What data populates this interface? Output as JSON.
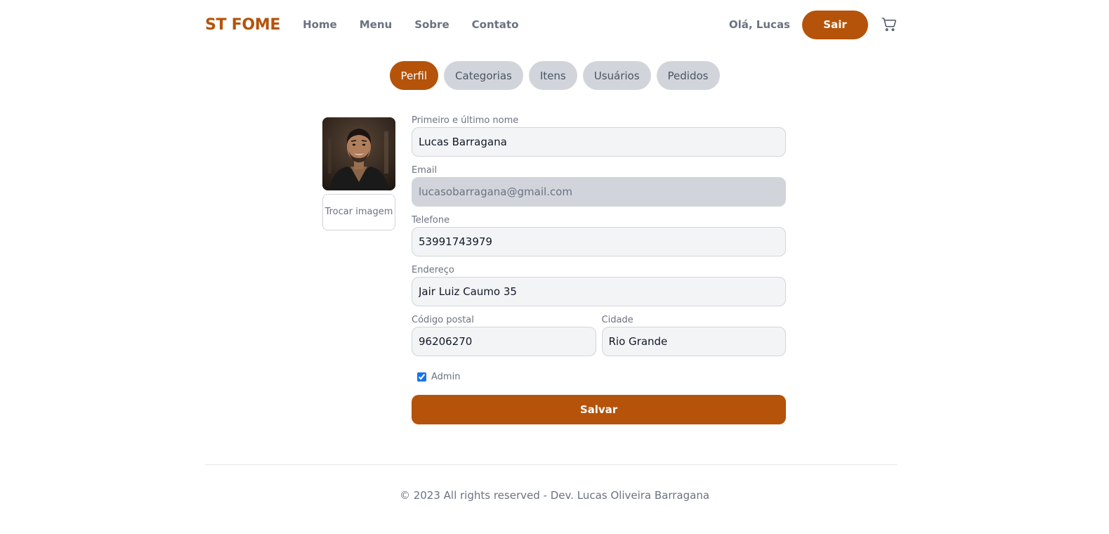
{
  "header": {
    "logo": "ST FOME",
    "nav": [
      {
        "label": "Home"
      },
      {
        "label": "Menu"
      },
      {
        "label": "Sobre"
      },
      {
        "label": "Contato"
      }
    ],
    "greeting": "Olá, Lucas",
    "logout_label": "Sair",
    "cart_icon": "cart-icon"
  },
  "tabs": [
    {
      "label": "Perfil",
      "active": true
    },
    {
      "label": "Categorias",
      "active": false
    },
    {
      "label": "Itens",
      "active": false
    },
    {
      "label": "Usuários",
      "active": false
    },
    {
      "label": "Pedidos",
      "active": false
    }
  ],
  "profile": {
    "change_image_label": "Trocar imagem",
    "name": {
      "label": "Primeiro e último nome",
      "value": "Lucas Barragana"
    },
    "email": {
      "label": "Email",
      "value": "lucasobarragana@gmail.com"
    },
    "phone": {
      "label": "Telefone",
      "value": "53991743979"
    },
    "address": {
      "label": "Endereço",
      "value": "Jair Luiz Caumo 35"
    },
    "postal_code": {
      "label": "Código postal",
      "value": "96206270"
    },
    "city": {
      "label": "Cidade",
      "value": "Rio Grande"
    },
    "admin": {
      "label": "Admin",
      "checked": true
    },
    "save_label": "Salvar"
  },
  "footer": {
    "text": "© 2023 All rights reserved - Dev. Lucas Oliveira Barragana"
  },
  "colors": {
    "accent": "#b45309",
    "tab_inactive": "#d1d5db",
    "input_bg": "#f3f4f6",
    "input_disabled_bg": "#d1d5db"
  }
}
